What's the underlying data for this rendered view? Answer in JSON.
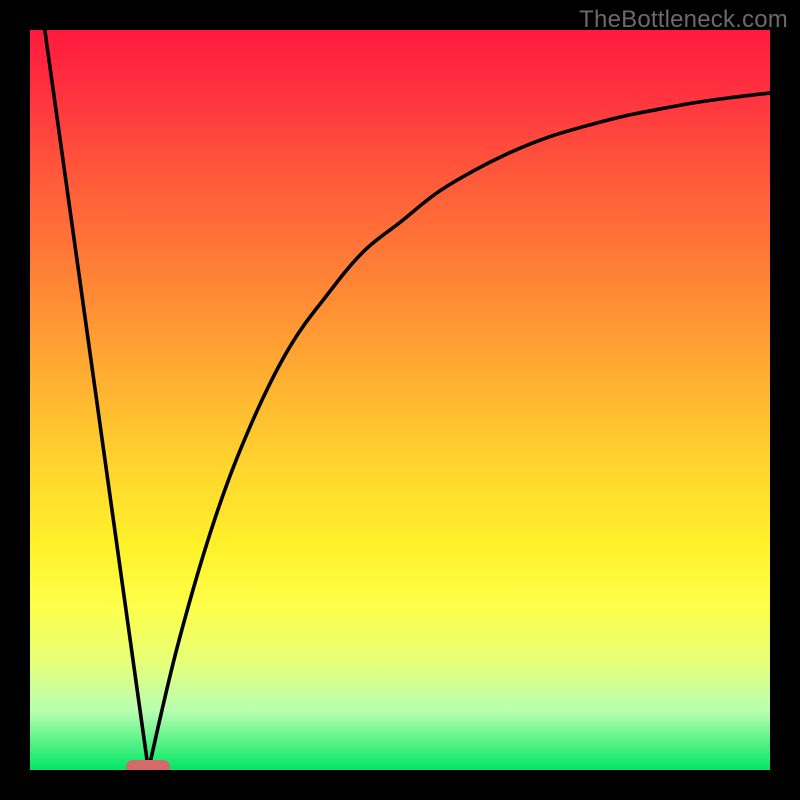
{
  "watermark": "TheBottleneck.com",
  "chart_data": {
    "type": "line",
    "title": "",
    "xlabel": "",
    "ylabel": "",
    "xlim": [
      0,
      100
    ],
    "ylim": [
      0,
      100
    ],
    "grid": false,
    "legend": false,
    "background_gradient": {
      "top_color": "#ff1a3c",
      "mid_color": "#fff22a",
      "bottom_color": "#00e765"
    },
    "optimal_x": 16,
    "optimal_marker_color": "#d46a6a",
    "series": [
      {
        "name": "left-branch",
        "description": "Line descending from top-left to the minimum",
        "x": [
          2,
          16
        ],
        "y": [
          100,
          0
        ]
      },
      {
        "name": "right-branch",
        "description": "Curve rising from minimum toward upper right, asymptotic",
        "x": [
          16,
          20,
          25,
          30,
          35,
          40,
          45,
          50,
          55,
          60,
          65,
          70,
          75,
          80,
          85,
          90,
          95,
          100
        ],
        "y": [
          0,
          17,
          34,
          47,
          57,
          64,
          70,
          74,
          78,
          81,
          83.5,
          85.5,
          87,
          88.3,
          89.3,
          90.2,
          90.9,
          91.5
        ]
      }
    ]
  }
}
